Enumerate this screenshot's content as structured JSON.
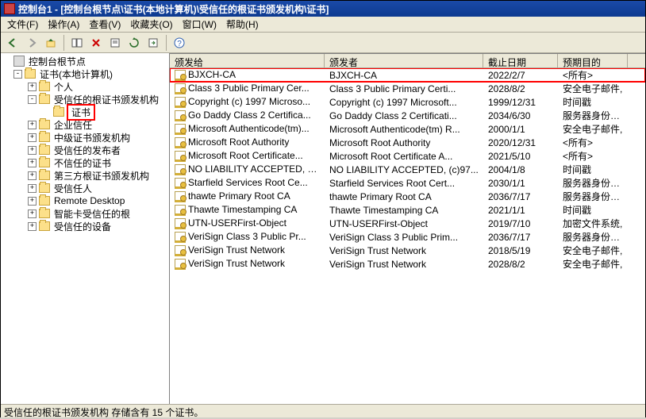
{
  "window": {
    "title": "控制台1 - [控制台根节点\\证书(本地计算机)\\受信任的根证书颁发机构\\证书]"
  },
  "menu": {
    "file": "文件(F)",
    "action": "操作(A)",
    "view": "查看(V)",
    "fav": "收藏夹(O)",
    "window": "窗口(W)",
    "help": "帮助(H)"
  },
  "tree": {
    "root": "控制台根节点",
    "cert_local": "证书(本地计算机)",
    "personal": "个人",
    "trusted_root": "受信任的根证书颁发机构",
    "certs": "证书",
    "enterprise": "企业信任",
    "intermediate": "中级证书颁发机构",
    "trusted_pub": "受信任的发布者",
    "untrusted": "不信任的证书",
    "third_party": "第三方根证书颁发机构",
    "trusted_people": "受信任人",
    "remote": "Remote Desktop",
    "smartcard": "智能卡受信任的根",
    "trusted_dev": "受信任的设备"
  },
  "columns": {
    "issued_to": "颁发给",
    "issued_by": "颁发者",
    "expiry": "截止日期",
    "purpose": "预期目的"
  },
  "rows": [
    {
      "to": "BJXCH-CA",
      "by": "BJXCH-CA",
      "exp": "2022/2/7",
      "purpose": "<所有>",
      "hl": true
    },
    {
      "to": "Class 3 Public Primary Cer...",
      "by": "Class 3 Public Primary Certi...",
      "exp": "2028/8/2",
      "purpose": "安全电子邮件,"
    },
    {
      "to": "Copyright (c) 1997 Microso...",
      "by": "Copyright (c) 1997 Microsoft...",
      "exp": "1999/12/31",
      "purpose": "时间戳"
    },
    {
      "to": "Go Daddy Class 2 Certifica...",
      "by": "Go Daddy Class 2 Certificati...",
      "exp": "2034/6/30",
      "purpose": "服务器身份验证"
    },
    {
      "to": "Microsoft Authenticode(tm)...",
      "by": "Microsoft Authenticode(tm) R...",
      "exp": "2000/1/1",
      "purpose": "安全电子邮件,"
    },
    {
      "to": "Microsoft Root Authority",
      "by": "Microsoft Root Authority",
      "exp": "2020/12/31",
      "purpose": "<所有>"
    },
    {
      "to": "Microsoft Root Certificate...",
      "by": "Microsoft Root Certificate A...",
      "exp": "2021/5/10",
      "purpose": "<所有>"
    },
    {
      "to": "NO LIABILITY ACCEPTED, (c)...",
      "by": "NO LIABILITY ACCEPTED, (c)97...",
      "exp": "2004/1/8",
      "purpose": "时间戳"
    },
    {
      "to": "Starfield Services Root Ce...",
      "by": "Starfield Services Root Cert...",
      "exp": "2030/1/1",
      "purpose": "服务器身份验证"
    },
    {
      "to": "thawte Primary Root CA",
      "by": "thawte Primary Root CA",
      "exp": "2036/7/17",
      "purpose": "服务器身份验证"
    },
    {
      "to": "Thawte Timestamping CA",
      "by": "Thawte Timestamping CA",
      "exp": "2021/1/1",
      "purpose": "时间戳"
    },
    {
      "to": "UTN-USERFirst-Object",
      "by": "UTN-USERFirst-Object",
      "exp": "2019/7/10",
      "purpose": "加密文件系统,"
    },
    {
      "to": "VeriSign Class 3 Public Pr...",
      "by": "VeriSign Class 3 Public Prim...",
      "exp": "2036/7/17",
      "purpose": "服务器身份验证"
    },
    {
      "to": "VeriSign Trust Network",
      "by": "VeriSign Trust Network",
      "exp": "2018/5/19",
      "purpose": "安全电子邮件,"
    },
    {
      "to": "VeriSign Trust Network",
      "by": "VeriSign Trust Network",
      "exp": "2028/8/2",
      "purpose": "安全电子邮件,"
    }
  ],
  "status": "受信任的根证书颁发机构 存储含有 15 个证书。"
}
